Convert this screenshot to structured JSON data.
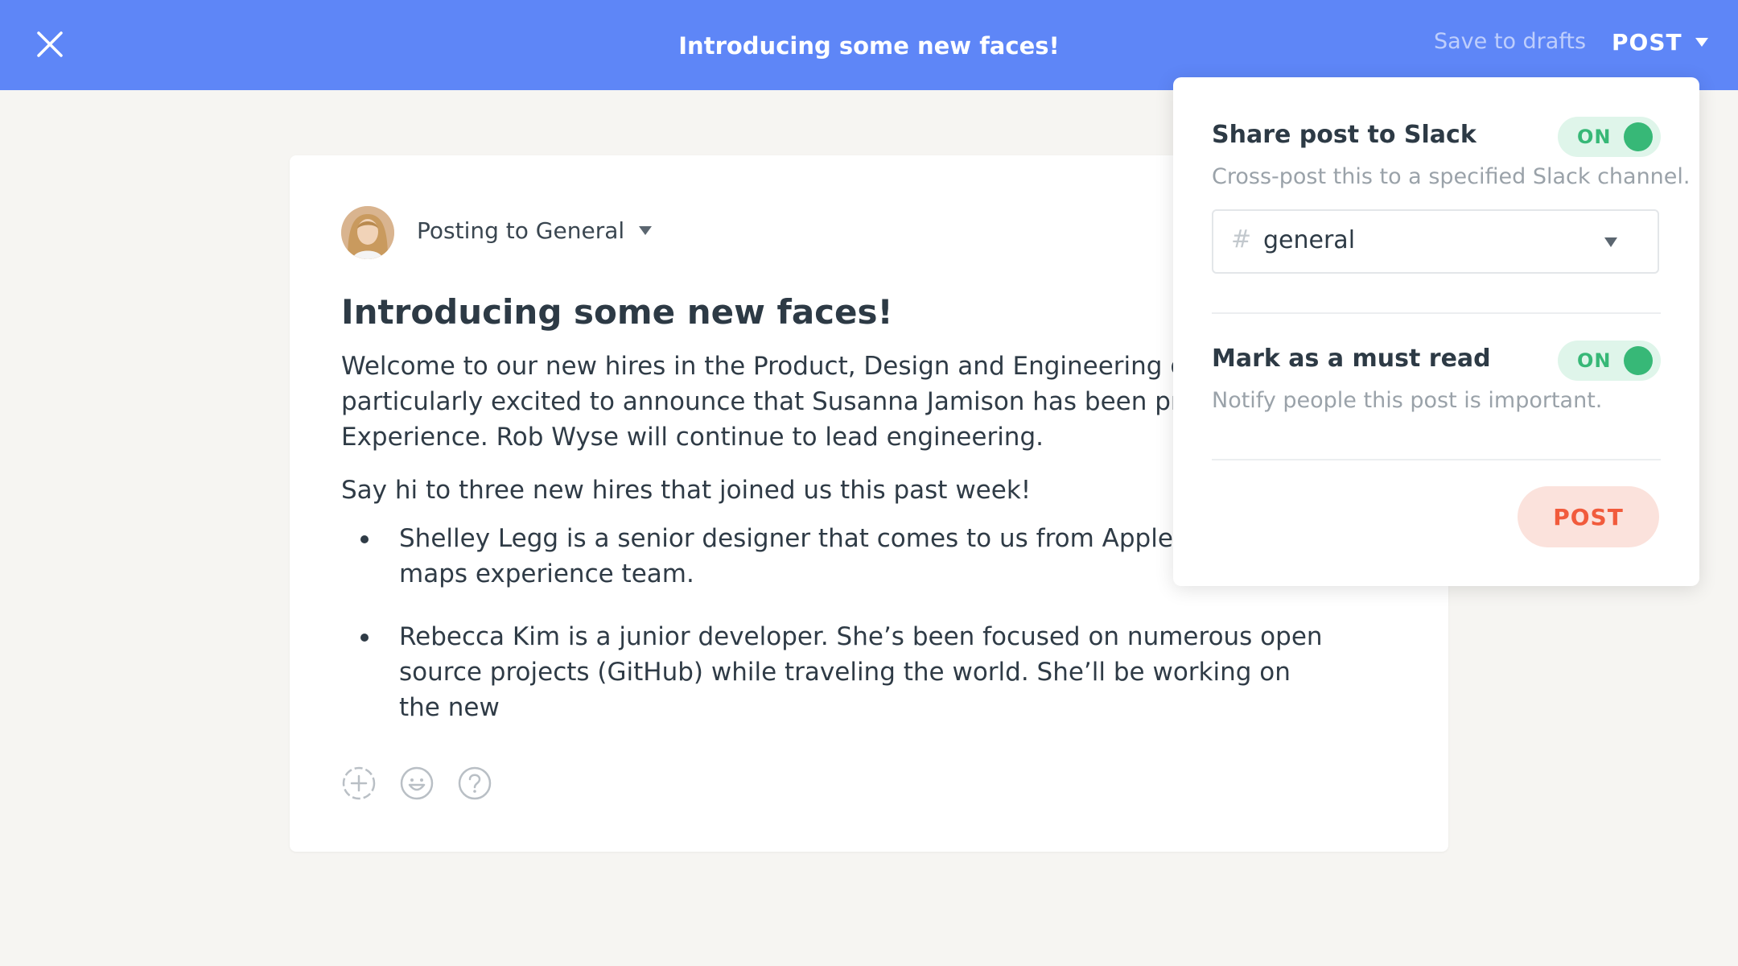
{
  "topbar": {
    "title": "Introducing some new faces!",
    "save_drafts_label": "Save to drafts",
    "post_label": "POST"
  },
  "editor": {
    "posting_to": "Posting to General",
    "post_title": "Introducing some new faces!",
    "paragraphs": [
      "Welcome to our new hires in the Product, Design and Engineering group particularly excited to announce that Susanna Jamison has been promot Customer Experience. Rob Wyse will continue to lead engineering.",
      "Say hi to three new hires that joined us this past week!"
    ],
    "bullets": [
      "Shelley Legg is a senior designer that comes to us from Apple wher Apple maps experience team.",
      "Rebecca Kim is a junior developer. She’s been focused on numerous open source projects (GitHub) while traveling the world. She’ll be working on the new"
    ],
    "toolbar_icons": [
      "add-circle-icon",
      "emoji-icon",
      "help-icon"
    ]
  },
  "post_options": {
    "slack": {
      "title": "Share post to Slack",
      "description": "Cross-post this to a specified Slack channel.",
      "toggle_label": "ON",
      "channel_hash": "#",
      "channel": "general"
    },
    "must_read": {
      "title": "Mark as a must read",
      "description": "Notify people this post is important.",
      "toggle_label": "ON"
    },
    "post_button_label": "POST"
  },
  "colors": {
    "topbar": "#5e86f7",
    "toggle_on": "#37b877",
    "post_button_text": "#f15b3c",
    "post_button_bg": "#fbe2dc"
  }
}
